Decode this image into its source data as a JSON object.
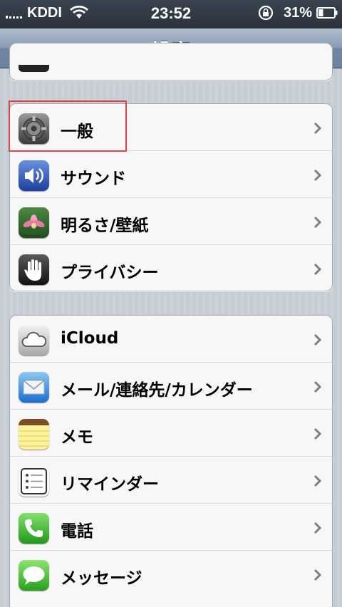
{
  "status_bar": {
    "carrier": "KDDI",
    "time": "23:52",
    "battery": "31%",
    "battery_level": 0.31
  },
  "nav": {
    "title": "設定"
  },
  "groups": [
    {
      "items": [
        {
          "label": "一般",
          "icon": "gear-icon"
        },
        {
          "label": "サウンド",
          "icon": "speaker-icon"
        },
        {
          "label": "明るさ/壁紙",
          "icon": "flower-wallpaper-icon"
        },
        {
          "label": "プライバシー",
          "icon": "hand-icon"
        }
      ]
    },
    {
      "items": [
        {
          "label": "iCloud",
          "icon": "cloud-icon"
        },
        {
          "label": "メール/連絡先/カレンダー",
          "icon": "mail-icon"
        },
        {
          "label": "メモ",
          "icon": "notes-icon"
        },
        {
          "label": "リマインダー",
          "icon": "reminders-icon"
        },
        {
          "label": "電話",
          "icon": "phone-icon"
        },
        {
          "label": "メッセージ",
          "icon": "messages-icon"
        }
      ]
    }
  ],
  "colors": {
    "highlight": "#e0454a",
    "nav_bar": "#6d83a2",
    "chevron": "#7f7f7f"
  }
}
